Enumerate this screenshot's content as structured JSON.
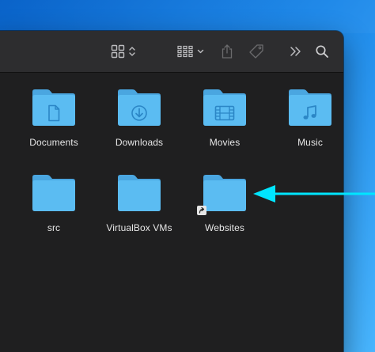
{
  "finder": {
    "items": [
      {
        "label": "Documents",
        "icon": "document-icon"
      },
      {
        "label": "Downloads",
        "icon": "download-icon"
      },
      {
        "label": "Movies",
        "icon": "film-icon"
      },
      {
        "label": "Music",
        "icon": "music-note-icon"
      },
      {
        "label": "src",
        "icon": ""
      },
      {
        "label": "VirtualBox VMs",
        "icon": ""
      },
      {
        "label": "Websites",
        "icon": "alias-arrow-icon"
      }
    ]
  },
  "colors": {
    "folder": "#5bbcf2",
    "folder_tab": "#4aa6e0",
    "arrow": "#00e5ff",
    "window_bg": "#1f1f20",
    "toolbar_bg": "#2d2d2f"
  },
  "toolbar_icons": [
    "view-grid-icon",
    "group-by-icon",
    "share-icon",
    "tag-icon",
    "more-icon",
    "search-icon"
  ]
}
